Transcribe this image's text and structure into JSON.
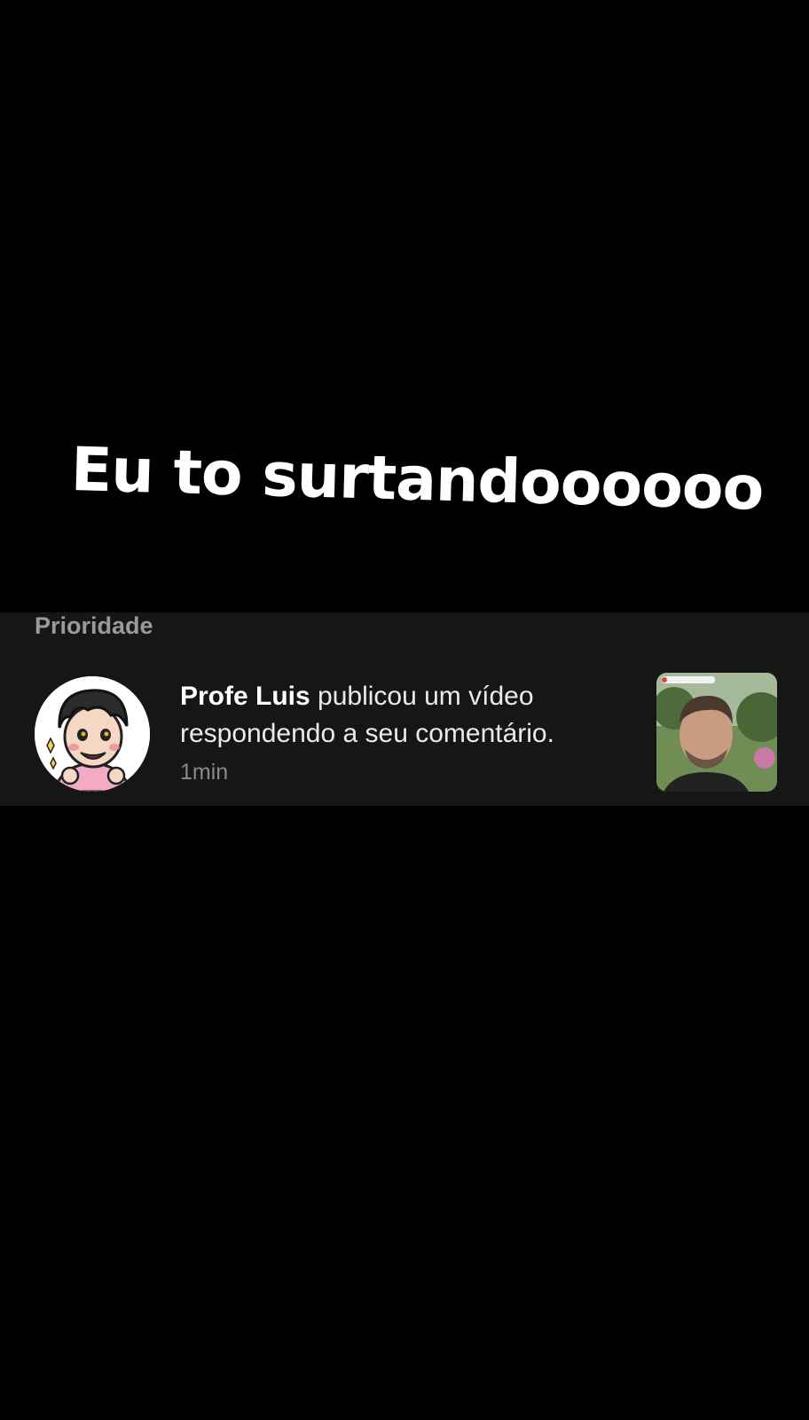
{
  "overlay": {
    "caption": "Eu to surtandoooooo"
  },
  "notifications": {
    "section_label": "Prioridade",
    "items": [
      {
        "username": "Profe Luis",
        "message": " publicou um vídeo respondendo a seu comentário.",
        "time": "1min",
        "avatar_icon": "cartoon-avatar-icon",
        "thumbnail_icon": "video-thumbnail"
      }
    ]
  },
  "colors": {
    "background": "#000000",
    "panel": "#161616",
    "text_primary": "#ffffff",
    "text_secondary": "#8a8a8a"
  }
}
